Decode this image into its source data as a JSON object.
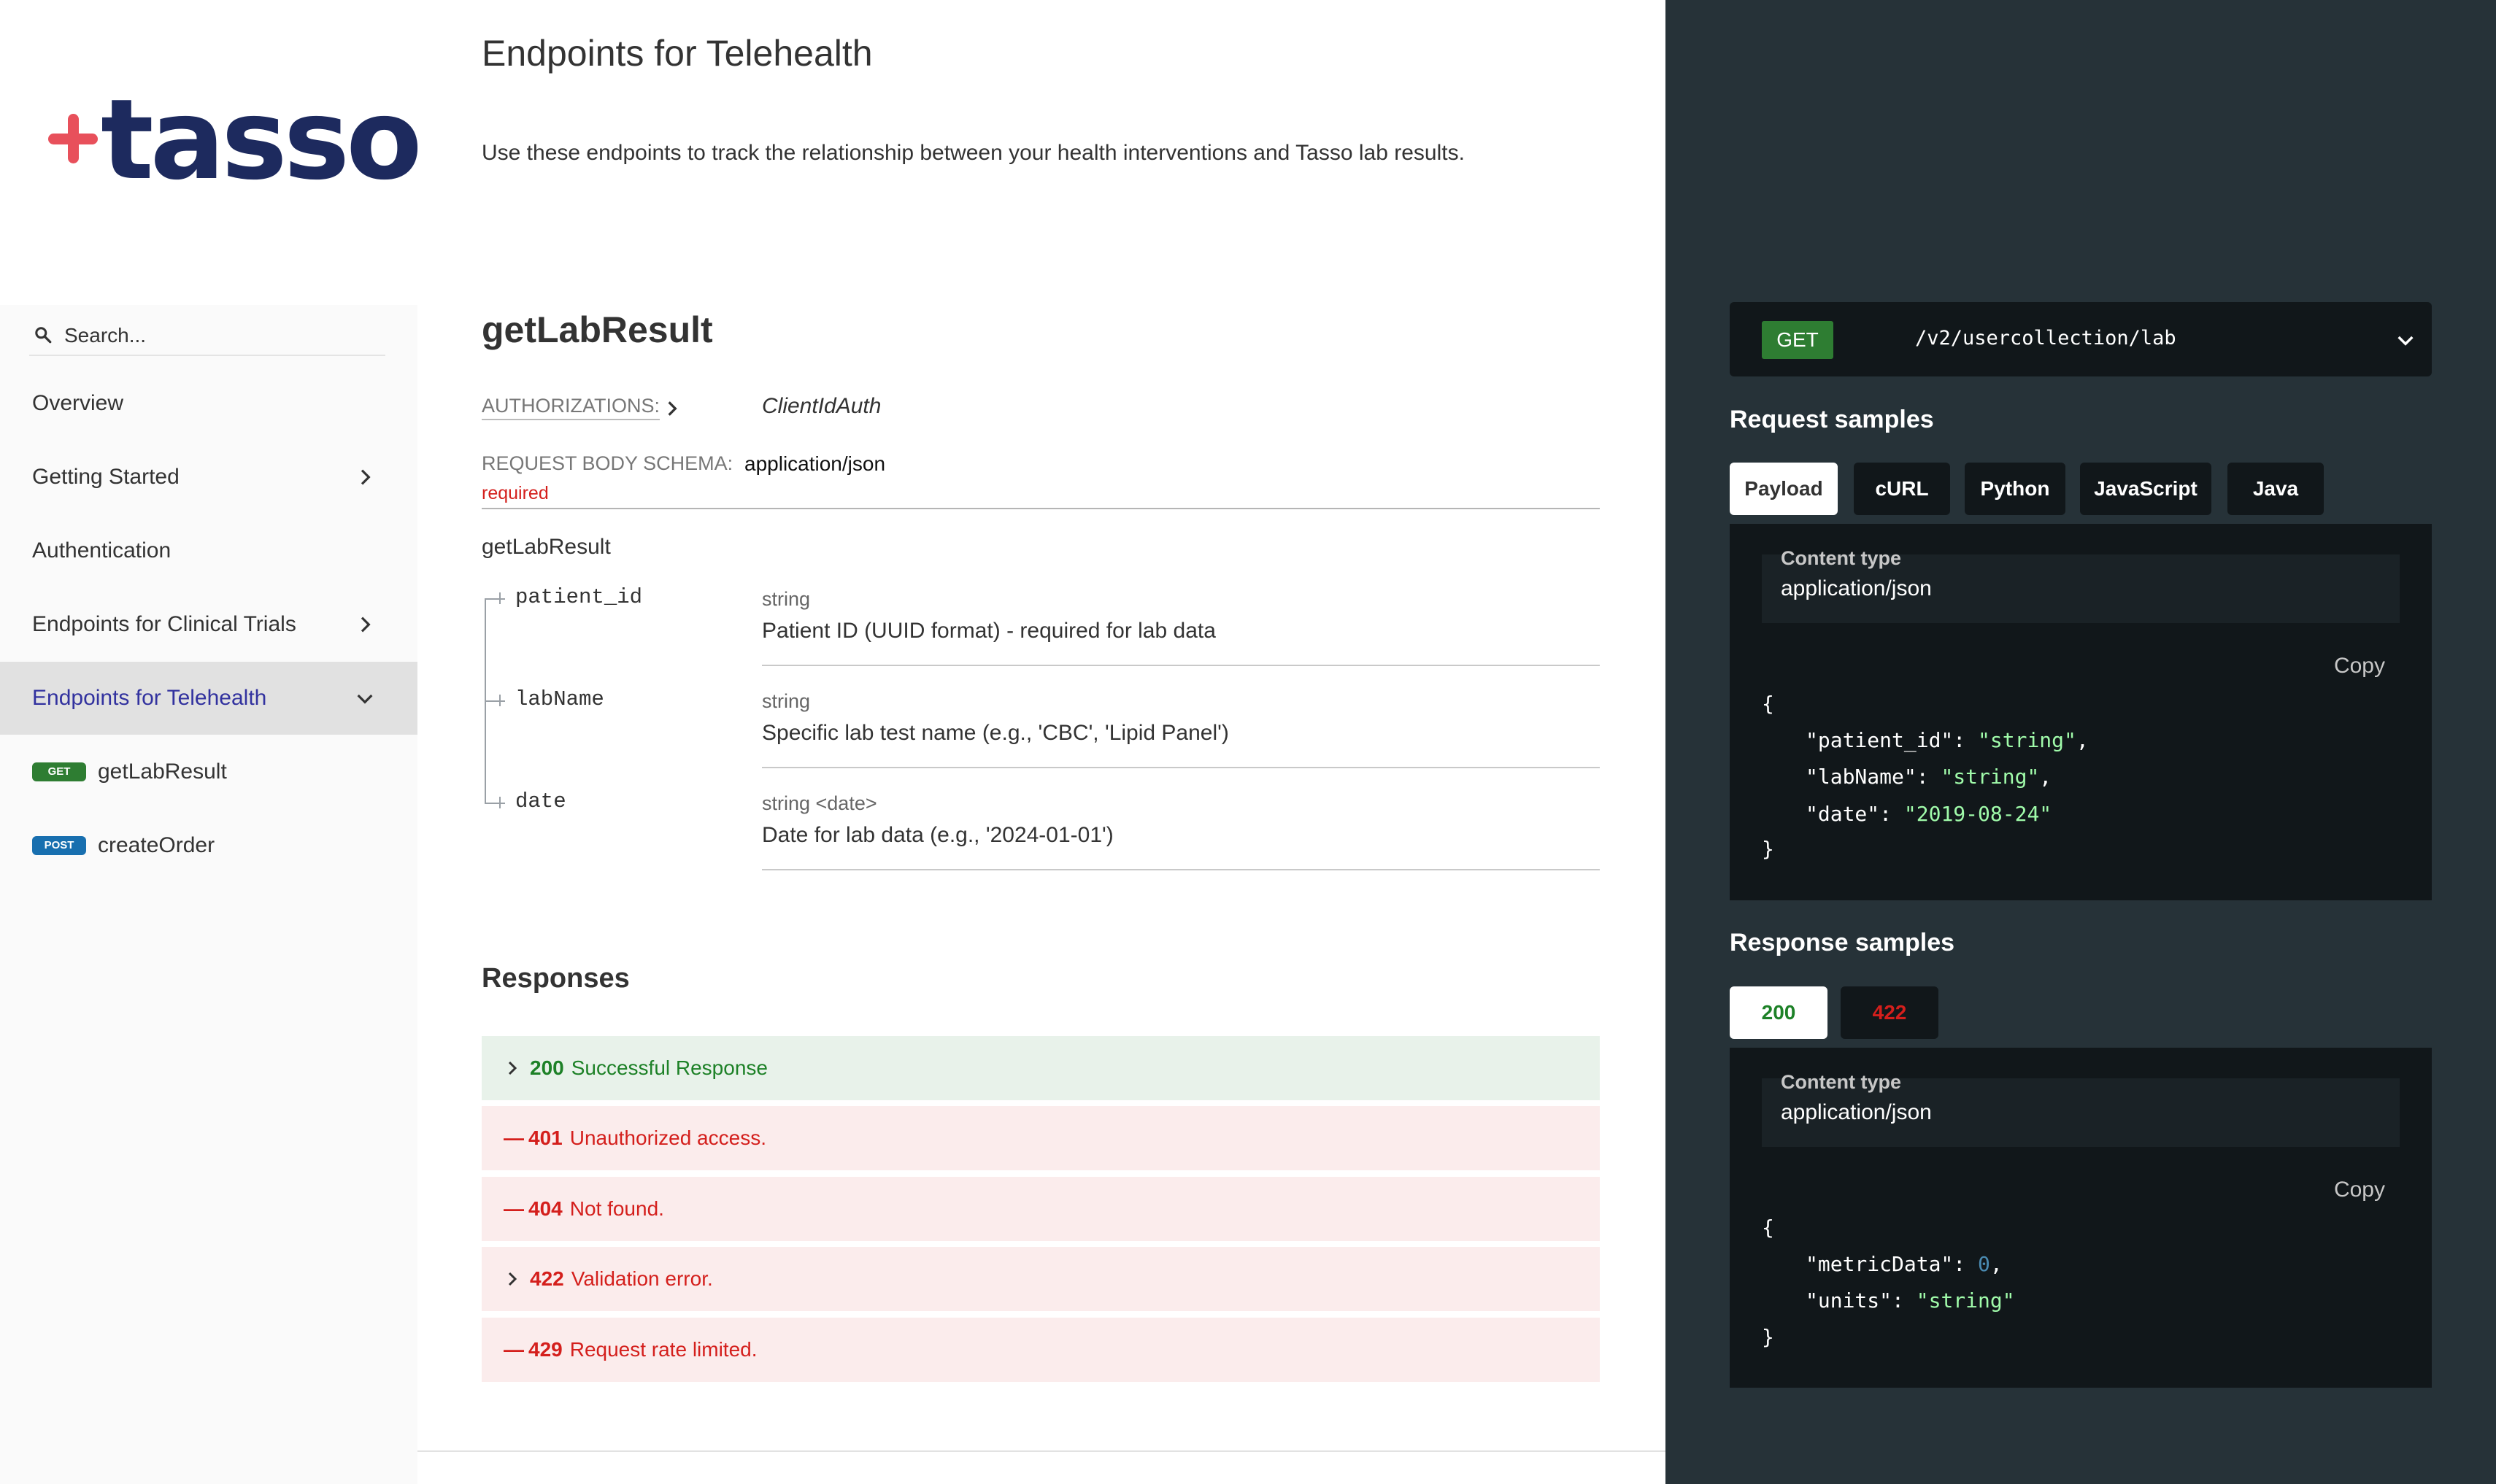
{
  "brand": {
    "name": "tasso",
    "accent_color": "#e8505b",
    "wordmark_color": "#1d2a5e"
  },
  "search": {
    "placeholder": "Search...",
    "icon": "search-icon"
  },
  "sidebar": {
    "items": [
      {
        "label": "Overview",
        "has_chevron": false
      },
      {
        "label": "Getting Started",
        "has_chevron": true
      },
      {
        "label": "Authentication",
        "has_chevron": false
      },
      {
        "label": "Endpoints for Clinical Trials",
        "has_chevron": true
      },
      {
        "label": "Endpoints for Telehealth",
        "has_chevron": true,
        "active": true
      }
    ],
    "operations": [
      {
        "method": "GET",
        "label": "getLabResult"
      },
      {
        "method": "POST",
        "label": "createOrder"
      }
    ]
  },
  "main": {
    "section_title": "Endpoints for Telehealth",
    "section_description": "Use these endpoints to track the relationship between your health interventions and Tasso lab results.",
    "operation_title": "getLabResult",
    "authorizations_label": "AUTHORIZATIONS:",
    "authorizations_value": "ClientIdAuth",
    "request_body_label": "REQUEST BODY SCHEMA:",
    "request_body_value": "application/json",
    "required_label": "required",
    "schema_name": "getLabResult",
    "properties": [
      {
        "name": "patient_id",
        "type": "string",
        "description": "Patient ID (UUID format) - required for lab data"
      },
      {
        "name": "labName",
        "type": "string",
        "description": "Specific lab test name (e.g., 'CBC', 'Lipid Panel')"
      },
      {
        "name": "date",
        "type": "string <date>",
        "description": "Date for lab data (e.g., '2024-01-01')"
      }
    ],
    "responses_title": "Responses",
    "responses": [
      {
        "code": "200",
        "text": "Successful Response",
        "status": "success",
        "expandable": true
      },
      {
        "code": "401",
        "text": "Unauthorized access.",
        "status": "error",
        "expandable": false
      },
      {
        "code": "404",
        "text": "Not found.",
        "status": "error",
        "expandable": false
      },
      {
        "code": "422",
        "text": "Validation error.",
        "status": "error",
        "expandable": true
      },
      {
        "code": "429",
        "text": "Request rate limited.",
        "status": "error",
        "expandable": false
      }
    ]
  },
  "right": {
    "endpoint": {
      "method": "GET",
      "path": "/v2/usercollection/lab"
    },
    "request_samples_title": "Request samples",
    "request_tabs": [
      "Payload",
      "cURL",
      "Python",
      "JavaScript",
      "Java"
    ],
    "request_active_tab": "Payload",
    "content_type_label": "Content type",
    "content_type_value": "application/json",
    "copy_label": "Copy",
    "request_code": {
      "open": "{",
      "lines": [
        {
          "key": "\"patient_id\"",
          "value": "\"string\"",
          "kind": "str",
          "comma": ","
        },
        {
          "key": "\"labName\"",
          "value": "\"string\"",
          "kind": "str",
          "comma": ","
        },
        {
          "key": "\"date\"",
          "value": "\"2019-08-24\"",
          "kind": "str",
          "comma": ""
        }
      ],
      "close": "}"
    },
    "response_samples_title": "Response samples",
    "response_tabs": [
      {
        "label": "200",
        "color": "#1d8127",
        "active": true
      },
      {
        "label": "422",
        "color": "#d41f1c",
        "active": false
      }
    ],
    "response_code": {
      "open": "{",
      "lines": [
        {
          "key": "\"metricData\"",
          "value": "0",
          "kind": "num",
          "comma": ","
        },
        {
          "key": "\"units\"",
          "value": "\"string\"",
          "kind": "str",
          "comma": ""
        }
      ],
      "close": "}"
    }
  },
  "colors": {
    "success_green": "#1d8127",
    "error_red": "#d41f1c",
    "active_nav": "#32329f",
    "right_panel_bg": "#263238",
    "code_bg": "#11171a"
  }
}
